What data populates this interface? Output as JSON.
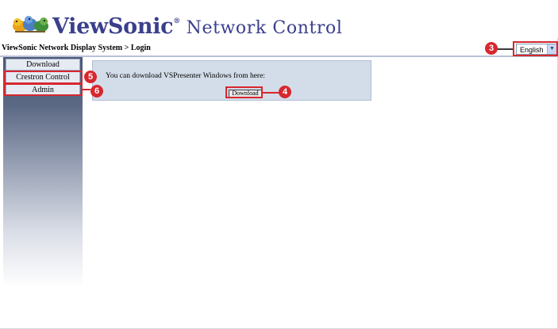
{
  "header": {
    "brand_main": "ViewSonic",
    "brand_reg": "®",
    "brand_sub": " Network Control"
  },
  "breadcrumb": "ViewSonic Network Display System > Login",
  "language": {
    "selected": "English"
  },
  "sidebar": {
    "items": [
      {
        "label": "Download"
      },
      {
        "label": "Crestron Control"
      },
      {
        "label": "Admin"
      }
    ]
  },
  "content": {
    "message": "You can download VSPresenter Windows from here:",
    "download_label": "Download"
  },
  "callouts": [
    "3",
    "4",
    "5",
    "6"
  ],
  "colors": {
    "accent": "#d8272e",
    "brand": "#3a3f8c",
    "panel": "#d3dde9"
  }
}
